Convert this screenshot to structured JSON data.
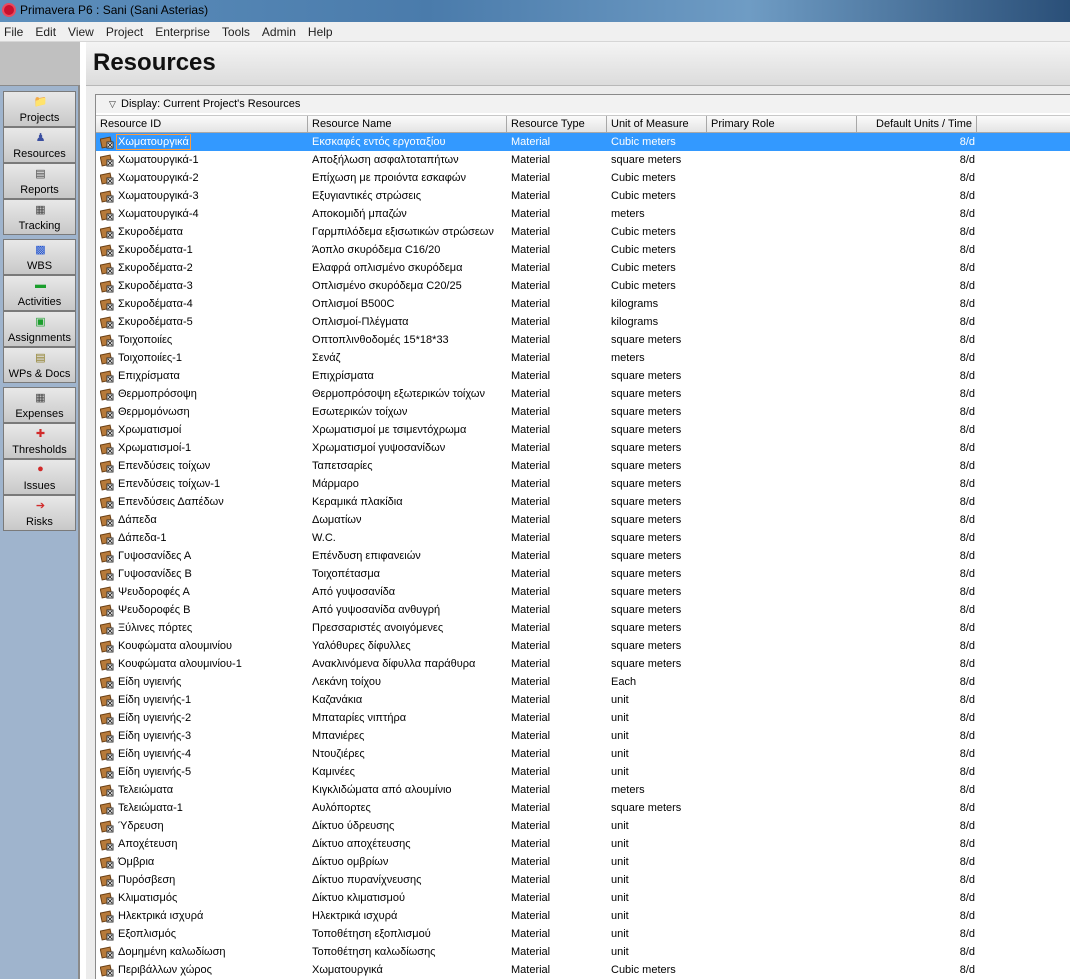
{
  "window": {
    "title": "Primavera P6 : Sani (Sani Asterias)"
  },
  "menu": [
    "File",
    "Edit",
    "View",
    "Project",
    "Enterprise",
    "Tools",
    "Admin",
    "Help"
  ],
  "nav": [
    {
      "label": "Projects",
      "icon": "projects-icon"
    },
    {
      "label": "Resources",
      "icon": "resources-icon"
    },
    {
      "label": "Reports",
      "icon": "reports-icon"
    },
    {
      "label": "Tracking",
      "icon": "tracking-icon"
    },
    {
      "label": "WBS",
      "icon": "wbs-icon"
    },
    {
      "label": "Activities",
      "icon": "activities-icon"
    },
    {
      "label": "Assignments",
      "icon": "assignments-icon"
    },
    {
      "label": "WPs & Docs",
      "icon": "wps-docs-icon"
    },
    {
      "label": "Expenses",
      "icon": "expenses-icon"
    },
    {
      "label": "Thresholds",
      "icon": "thresholds-icon"
    },
    {
      "label": "Issues",
      "icon": "issues-icon"
    },
    {
      "label": "Risks",
      "icon": "risks-icon"
    }
  ],
  "page": {
    "title": "Resources",
    "display_filter": "Display: Current Project's Resources"
  },
  "columns": [
    "Resource ID",
    "Resource Name",
    "Resource Type",
    "Unit of Measure",
    "Primary Role",
    "Default Units / Time"
  ],
  "rows": [
    [
      "Χωματουργικά",
      "Εκσκαφές εντός εργοταξίου",
      "Material",
      "Cubic meters",
      "",
      "8/d"
    ],
    [
      "Χωματουργικά-1",
      "Αποξήλωση ασφαλτοταπήτων",
      "Material",
      "square meters",
      "",
      "8/d"
    ],
    [
      "Χωματουργικά-2",
      "Επίχωση με προιόντα εσκαφών",
      "Material",
      "Cubic meters",
      "",
      "8/d"
    ],
    [
      "Χωματουργικά-3",
      "Εξυγιαντικές στρώσεις",
      "Material",
      "Cubic meters",
      "",
      "8/d"
    ],
    [
      "Χωματουργικά-4",
      "Αποκομιδή μπαζών",
      "Material",
      "meters",
      "",
      "8/d"
    ],
    [
      "Σκυροδέματα",
      "Γαρμπιλόδεμα εξισωτικών στρώσεων",
      "Material",
      "Cubic meters",
      "",
      "8/d"
    ],
    [
      "Σκυροδέματα-1",
      "Άοπλο σκυρόδεμα C16/20",
      "Material",
      "Cubic meters",
      "",
      "8/d"
    ],
    [
      "Σκυροδέματα-2",
      "Ελαφρά οπλισμένο σκυρόδεμα",
      "Material",
      "Cubic meters",
      "",
      "8/d"
    ],
    [
      "Σκυροδέματα-3",
      "Οπλισμένο σκυρόδεμα C20/25",
      "Material",
      "Cubic meters",
      "",
      "8/d"
    ],
    [
      "Σκυροδέματα-4",
      "Οπλισμοί B500C",
      "Material",
      "kilograms",
      "",
      "8/d"
    ],
    [
      "Σκυροδέματα-5",
      "Οπλισμοί-Πλέγματα",
      "Material",
      "kilograms",
      "",
      "8/d"
    ],
    [
      "Τοιχοποιίες",
      "Οπτοπλινθοδομές 15*18*33",
      "Material",
      "square meters",
      "",
      "8/d"
    ],
    [
      "Τοιχοποιίες-1",
      "Σενάζ",
      "Material",
      "meters",
      "",
      "8/d"
    ],
    [
      "Επιχρίσματα",
      "Επιχρίσματα",
      "Material",
      "square meters",
      "",
      "8/d"
    ],
    [
      "Θερμοπρόσοψη",
      "Θερμοπρόσοψη εξωτερικών τοίχων",
      "Material",
      "square meters",
      "",
      "8/d"
    ],
    [
      "Θερμομόνωση",
      "Εσωτερικών τοίχων",
      "Material",
      "square meters",
      "",
      "8/d"
    ],
    [
      "Χρωματισμοί",
      "Χρωματισμοί με τσιμεντόχρωμα",
      "Material",
      "square meters",
      "",
      "8/d"
    ],
    [
      "Χρωματισμοί-1",
      "Χρωματισμοί γυψοσανίδων",
      "Material",
      "square meters",
      "",
      "8/d"
    ],
    [
      "Επενδύσεις τοίχων",
      "Ταπετσαρίες",
      "Material",
      "square meters",
      "",
      "8/d"
    ],
    [
      "Επενδύσεις τοίχων-1",
      "Μάρμαρο",
      "Material",
      "square meters",
      "",
      "8/d"
    ],
    [
      "Επενδύσεις Δαπέδων",
      "Κεραμικά πλακίδια",
      "Material",
      "square meters",
      "",
      "8/d"
    ],
    [
      "Δάπεδα",
      "Δωματίων",
      "Material",
      "square meters",
      "",
      "8/d"
    ],
    [
      "Δάπεδα-1",
      "W.C.",
      "Material",
      "square meters",
      "",
      "8/d"
    ],
    [
      "Γυψοσανίδες Α",
      "Επένδυση επιφανειών",
      "Material",
      "square meters",
      "",
      "8/d"
    ],
    [
      "Γυψοσανίδες Β",
      "Τοιχοπέτασμα",
      "Material",
      "square meters",
      "",
      "8/d"
    ],
    [
      "Ψευδοροφές Α",
      "Από γυψοσανίδα",
      "Material",
      "square meters",
      "",
      "8/d"
    ],
    [
      "Ψευδοροφές Β",
      "Από γυψοσανίδα ανθυγρή",
      "Material",
      "square meters",
      "",
      "8/d"
    ],
    [
      "Ξύλινες πόρτες",
      "Πρεσσαριστές ανοιγόμενες",
      "Material",
      "square meters",
      "",
      "8/d"
    ],
    [
      "Κουφώματα αλουμινίου",
      "Υαλόθυρες δίφυλλες",
      "Material",
      "square meters",
      "",
      "8/d"
    ],
    [
      "Κουφώματα αλουμινίου-1",
      "Ανακλινόμενα δίφυλλα παράθυρα",
      "Material",
      "square meters",
      "",
      "8/d"
    ],
    [
      "Είδη υγιεινής",
      "Λεκάνη τοίχου",
      "Material",
      "Each",
      "",
      "8/d"
    ],
    [
      "Είδη υγιεινής-1",
      "Καζανάκια",
      "Material",
      "unit",
      "",
      "8/d"
    ],
    [
      "Είδη υγιεινής-2",
      "Μπαταρίες νιπτήρα",
      "Material",
      "unit",
      "",
      "8/d"
    ],
    [
      "Είδη υγιεινής-3",
      "Μπανιέρες",
      "Material",
      "unit",
      "",
      "8/d"
    ],
    [
      "Είδη υγιεινής-4",
      "Ντουζιέρες",
      "Material",
      "unit",
      "",
      "8/d"
    ],
    [
      "Είδη υγιεινής-5",
      "Καμινέες",
      "Material",
      "unit",
      "",
      "8/d"
    ],
    [
      "Τελειώματα",
      "Κιγκλιδώματα από αλουμίνιο",
      "Material",
      "meters",
      "",
      "8/d"
    ],
    [
      "Τελειώματα-1",
      "Αυλόπορτες",
      "Material",
      "square meters",
      "",
      "8/d"
    ],
    [
      "Ύδρευση",
      "Δίκτυο ύδρευσης",
      "Material",
      "unit",
      "",
      "8/d"
    ],
    [
      "Αποχέτευση",
      "Δίκτυο αποχέτευσης",
      "Material",
      "unit",
      "",
      "8/d"
    ],
    [
      "Όμβρια",
      "Δίκτυο ομβρίων",
      "Material",
      "unit",
      "",
      "8/d"
    ],
    [
      "Πυρόσβεση",
      "Δίκτυο πυρανίχνευσης",
      "Material",
      "unit",
      "",
      "8/d"
    ],
    [
      "Κλιματισμός",
      "Δίκτυο κλιματισμού",
      "Material",
      "unit",
      "",
      "8/d"
    ],
    [
      "Ηλεκτρικά ισχυρά",
      "Ηλεκτρικά ισχυρά",
      "Material",
      "unit",
      "",
      "8/d"
    ],
    [
      "Εξοπλισμός",
      "Τοποθέτηση εξοπλισμού",
      "Material",
      "unit",
      "",
      "8/d"
    ],
    [
      "Δομημένη καλωδίωση",
      "Τοποθέτηση καλωδίωσης",
      "Material",
      "unit",
      "",
      "8/d"
    ],
    [
      "Περιβάλλων χώρος",
      "Χωματουργικά",
      "Material",
      "Cubic meters",
      "",
      "8/d"
    ]
  ],
  "colors": {
    "selection": "#3399ff",
    "sidebar": "#9fb4cd"
  }
}
